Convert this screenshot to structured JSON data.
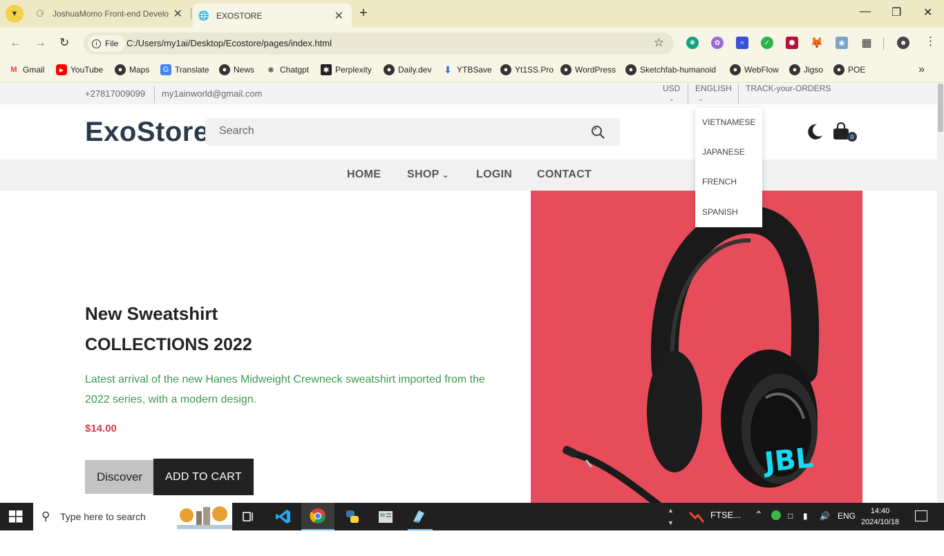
{
  "browser": {
    "tabs": [
      {
        "title": "JoshuaMomo Front-end Develo"
      },
      {
        "title": "EXOSTORE"
      }
    ],
    "omnibox": {
      "scheme_label": "File",
      "url": "C:/Users/my1ai/Desktop/Ecostore/pages/index.html"
    },
    "bookmarks": [
      {
        "label": "Gmail",
        "icon": "gmail-icon"
      },
      {
        "label": "YouTube",
        "icon": "youtube-icon"
      },
      {
        "label": "Maps",
        "icon": "globe-icon"
      },
      {
        "label": "Translate",
        "icon": "translate-icon"
      },
      {
        "label": "News",
        "icon": "globe-icon"
      },
      {
        "label": "Chatgpt",
        "icon": "chatgpt-icon"
      },
      {
        "label": "Perplexity",
        "icon": "perplexity-icon"
      },
      {
        "label": "Daily.dev",
        "icon": "globe-icon"
      },
      {
        "label": "YTBSave",
        "icon": "download-icon"
      },
      {
        "label": "Yt1SS.Pro",
        "icon": "globe-icon"
      },
      {
        "label": "WordPress",
        "icon": "globe-icon"
      },
      {
        "label": "Sketchfab-humanoid",
        "icon": "globe-icon"
      },
      {
        "label": "WebFlow",
        "icon": "globe-icon"
      },
      {
        "label": "Jigso",
        "icon": "globe-icon"
      },
      {
        "label": "POE",
        "icon": "globe-icon"
      }
    ]
  },
  "site": {
    "topbar": {
      "phone": "+27817009099",
      "email": "my1ainworld@gmail.com",
      "currency": "USD",
      "language": "ENGLISH",
      "track": "TRACK-your-ORDERS"
    },
    "language_menu": [
      "VIETNAMESE",
      "JAPANESE",
      "FRENCH",
      "SPANISH"
    ],
    "logo": "ExoStore",
    "search_placeholder": "Search",
    "cart_count": "0",
    "nav": [
      "HOME",
      "SHOP",
      "LOGIN",
      "CONTACT"
    ],
    "hero": {
      "title": "New Sweatshirt",
      "subtitle": "COLLECTIONS 2022",
      "description": "Latest arrival of the new Hanes Midweight Crewneck sweatshirt imported from the 2022 series, with a modern design.",
      "price": "$14.00",
      "discover_label": "Discover",
      "cart_label": "ADD TO CART",
      "product_brand": "JBL"
    },
    "colors": {
      "accent": "#3d9a4e",
      "price": "#d63a4a",
      "hero_bg": "#e74c5a",
      "brand": "#2b3a4a"
    }
  },
  "taskbar": {
    "search_placeholder": "Type here to search",
    "widget": "FTSE...",
    "lang": "ENG",
    "time": "14:40",
    "date": "2024/10/18"
  }
}
